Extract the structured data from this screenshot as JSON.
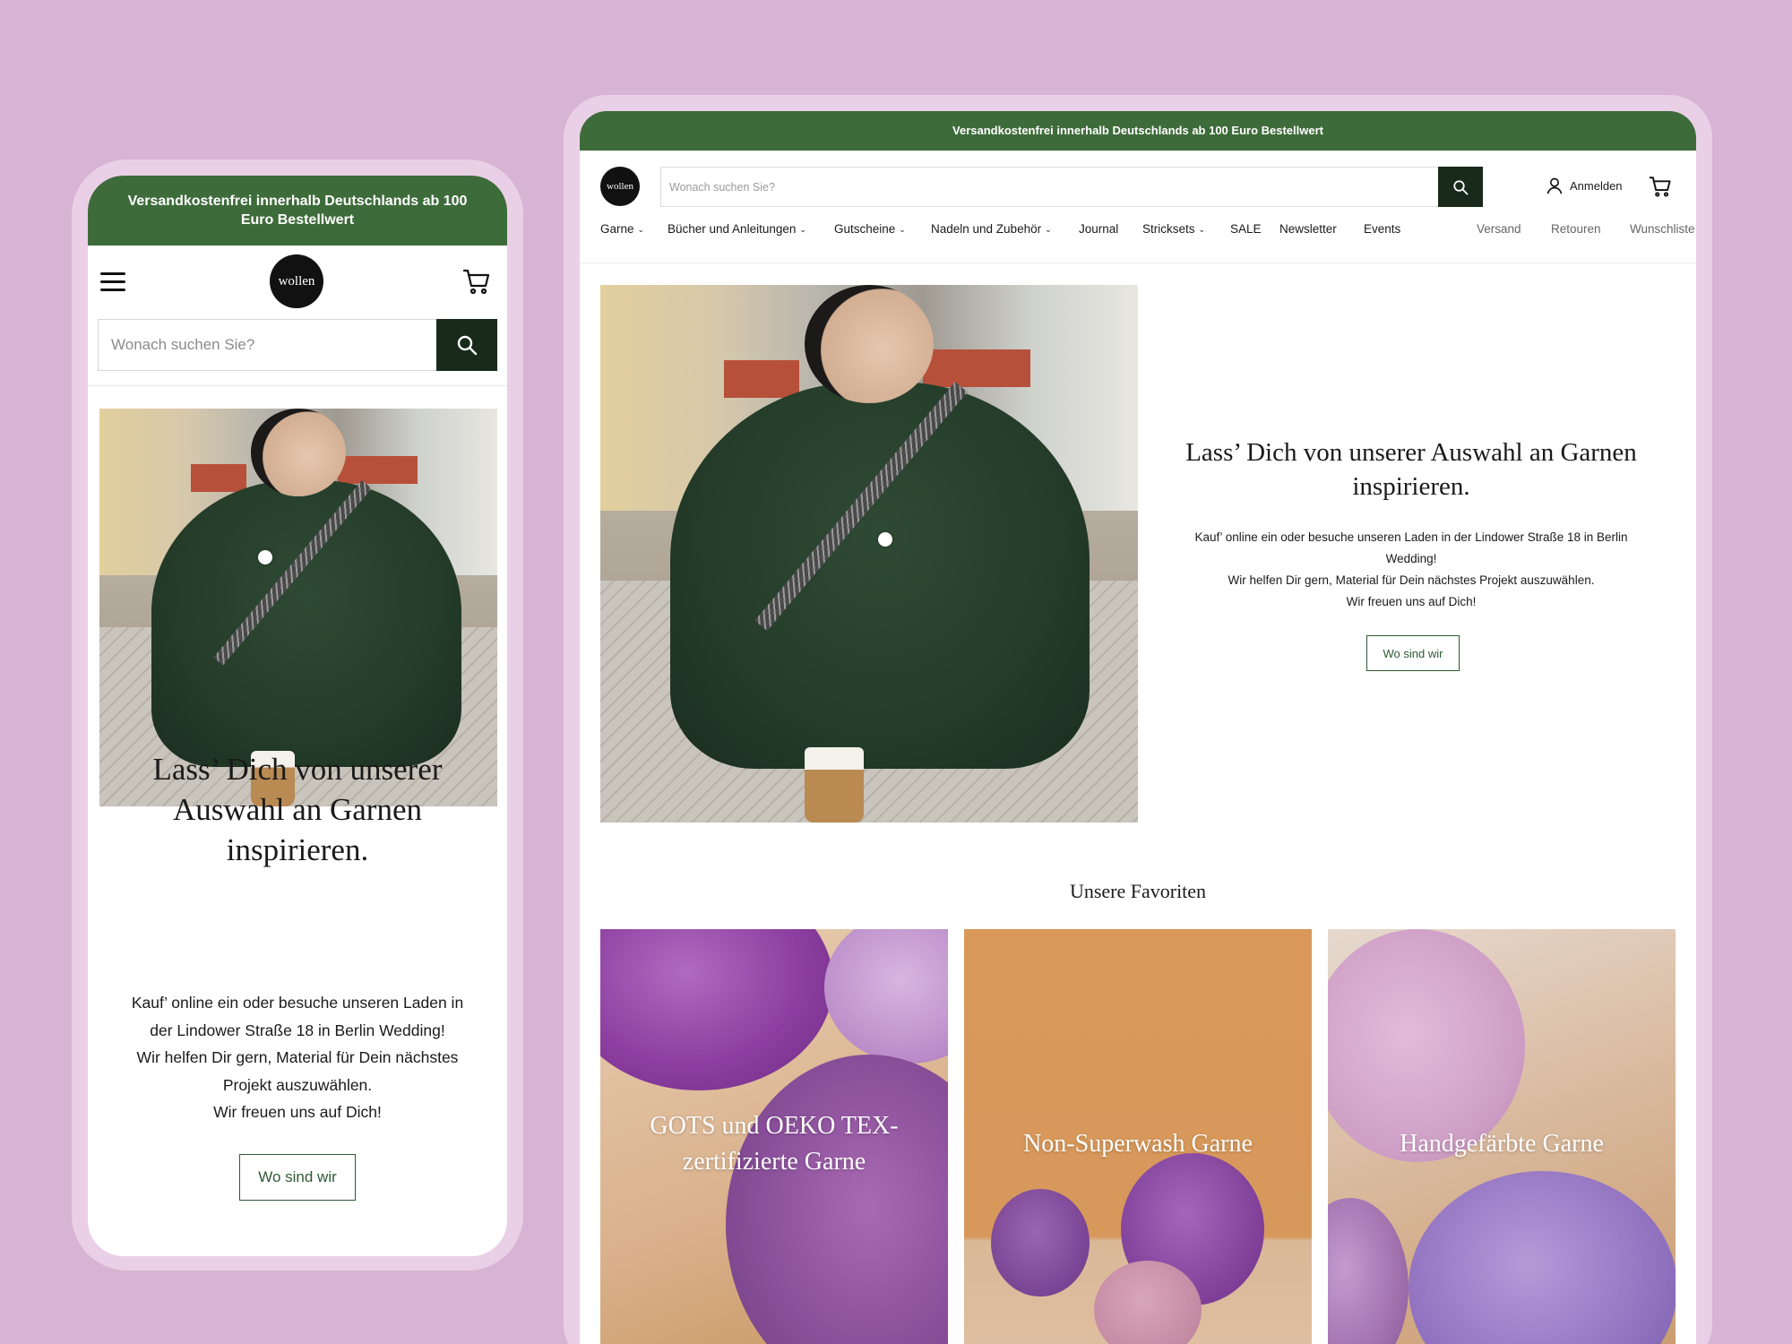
{
  "announcement": "Versandkostenfrei innerhalb Deutschlands ab 100 Euro Bestellwert",
  "logo_text": "wollen",
  "search": {
    "placeholder": "Wonach suchen Sie?"
  },
  "header": {
    "account_label": "Anmelden"
  },
  "nav": {
    "main": [
      "Garne",
      "Bücher und Anleitungen",
      "Gutscheine",
      "Nadeln und Zubehör",
      "Journal",
      "Stricksets",
      "SALE",
      "Newsletter",
      "Events"
    ],
    "utility": [
      "Versand",
      "Retouren",
      "Wunschliste"
    ]
  },
  "hero": {
    "heading": "Lass’ Dich von unserer Auswahl an Garnen inspirieren.",
    "body_lines": [
      "Kauf’ online ein oder besuche unseren Laden in der Lindower Straße 18 in Berlin Wedding!",
      "Wir helfen Dir gern, Material für Dein nächstes Projekt auszuwählen.",
      "Wir freuen uns auf Dich!"
    ],
    "button_label": "Wo sind wir"
  },
  "favorites": {
    "title": "Unsere Favoriten",
    "tiles": [
      {
        "label": "GOTS und OEKO TEX-zertifizierte Garne"
      },
      {
        "label": "Non-Superwash Garne"
      },
      {
        "label": "Handgefärbte Garne"
      }
    ]
  },
  "colors": {
    "background": "#d7b4d4",
    "frame": "#ead0e6",
    "announcement_bar": "#3e6b3a",
    "search_button": "#192a1b",
    "button_outline": "#2f5a35"
  },
  "icons": [
    "menu-icon",
    "cart-icon",
    "search-icon",
    "user-icon",
    "chevron-down-icon"
  ]
}
